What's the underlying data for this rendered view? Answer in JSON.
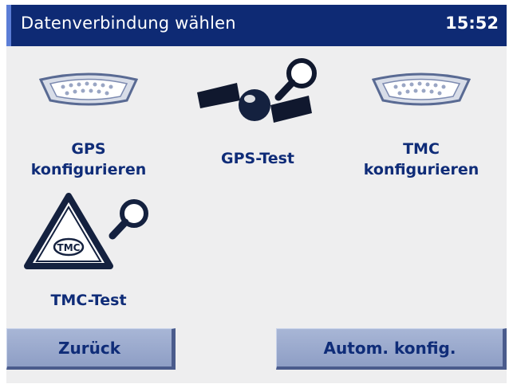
{
  "header": {
    "title": "Datenverbindung wählen",
    "time": "15:52"
  },
  "tiles": [
    {
      "label": "GPS\nkonfigurieren",
      "icon": "serial-connector-icon"
    },
    {
      "label": "GPS-Test",
      "icon": "satellite-search-icon"
    },
    {
      "label": "TMC\nkonfigurieren",
      "icon": "serial-connector-icon"
    },
    {
      "label": "TMC-Test",
      "icon": "tmc-sign-search-icon"
    }
  ],
  "footer": {
    "back_label": "Zurück",
    "auto_label": "Autom. konfig."
  },
  "colors": {
    "header": "#0e2a74",
    "label": "#0f2c78",
    "button": "#98a8cd",
    "background": "#eeeeef"
  }
}
